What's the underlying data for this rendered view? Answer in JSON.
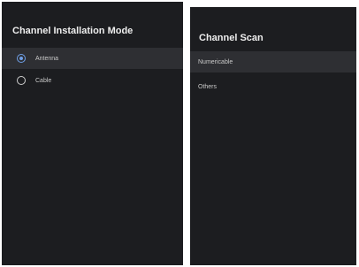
{
  "install_mode": {
    "title": "Channel Installation Mode",
    "options": [
      {
        "label": "Antenna",
        "selected": true
      },
      {
        "label": "Cable",
        "selected": false
      }
    ]
  },
  "channel_scan": {
    "title": "Channel Scan",
    "items": [
      {
        "label": "Numericable",
        "highlighted": true
      },
      {
        "label": "Others",
        "highlighted": false
      }
    ]
  },
  "colors": {
    "panel_bg": "#1c1d20",
    "highlight_row": "#2e2f33",
    "accent": "#6fa0e8"
  }
}
